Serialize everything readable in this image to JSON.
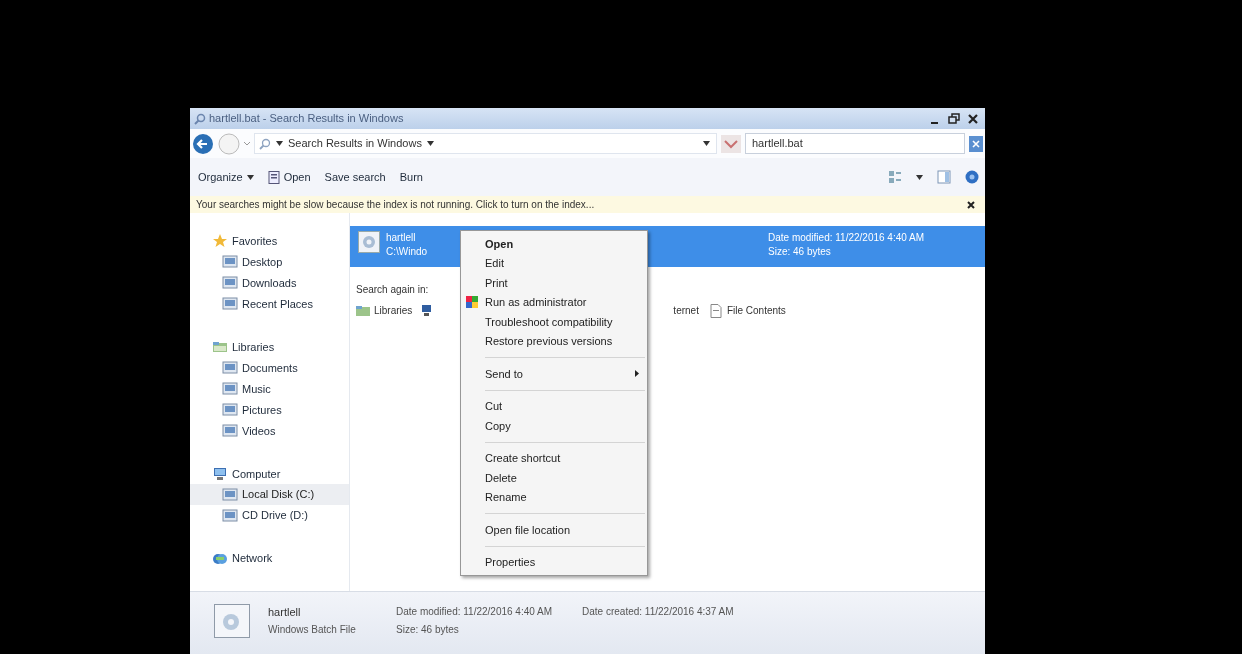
{
  "window": {
    "title": "hartlell.bat - Search Results in Windows"
  },
  "address_bar": {
    "location": "Search Results in Windows",
    "search_value": "hartlell.bat"
  },
  "toolbar": [
    {
      "label": "Organize",
      "dropdown": true,
      "icon": false
    },
    {
      "label": "Open",
      "dropdown": false,
      "icon": true
    },
    {
      "label": "Save search",
      "dropdown": false,
      "icon": false
    },
    {
      "label": "Burn",
      "dropdown": false,
      "icon": false
    }
  ],
  "info_bar": {
    "text": "Your searches might be slow because the index is not running.  Click to turn on the index..."
  },
  "sidebar": [
    {
      "label": "Favorites",
      "children": [
        {
          "label": "Desktop",
          "selected": false
        },
        {
          "label": "Downloads",
          "selected": false
        },
        {
          "label": "Recent Places",
          "selected": false
        }
      ]
    },
    {
      "label": "Libraries",
      "children": [
        {
          "label": "Documents",
          "selected": false
        },
        {
          "label": "Music",
          "selected": false
        },
        {
          "label": "Pictures",
          "selected": false
        },
        {
          "label": "Videos",
          "selected": false
        }
      ]
    },
    {
      "label": "Computer",
      "children": [
        {
          "label": "Local Disk (C:)",
          "selected": true
        },
        {
          "label": "CD Drive (D:)",
          "selected": false
        }
      ]
    },
    {
      "label": "Network"
    }
  ],
  "results": [
    {
      "name": "hartlell",
      "path": "C:\\Windo",
      "date_modified": "Date modified: 11/22/2016 4:40 AM",
      "size": "Size: 46 bytes",
      "selected": true
    }
  ],
  "search_again": {
    "label": "Search again in:",
    "locations": [
      {
        "kind": "full",
        "label": "Libraries"
      },
      {
        "kind": "icon_only"
      },
      {
        "kind": "text_only",
        "label": "ternet"
      },
      {
        "kind": "full",
        "label": "File Contents"
      }
    ]
  },
  "context_menu": [
    [
      {
        "label": "Open",
        "default": true,
        "shield": false,
        "submenu": false
      },
      {
        "label": "Edit",
        "default": false,
        "shield": false,
        "submenu": false
      },
      {
        "label": "Print",
        "default": false,
        "shield": false,
        "submenu": false
      },
      {
        "label": "Run as administrator",
        "default": false,
        "shield": true,
        "submenu": false
      },
      {
        "label": "Troubleshoot compatibility",
        "default": false,
        "shield": false,
        "submenu": false
      },
      {
        "label": "Restore previous versions",
        "default": false,
        "shield": false,
        "submenu": false
      }
    ],
    [
      {
        "label": "Send to",
        "default": false,
        "shield": false,
        "submenu": true
      }
    ],
    [
      {
        "label": "Cut",
        "default": false,
        "shield": false,
        "submenu": false
      },
      {
        "label": "Copy",
        "default": false,
        "shield": false,
        "submenu": false
      }
    ],
    [
      {
        "label": "Create shortcut",
        "default": false,
        "shield": false,
        "submenu": false
      },
      {
        "label": "Delete",
        "default": false,
        "shield": false,
        "submenu": false
      },
      {
        "label": "Rename",
        "default": false,
        "shield": false,
        "submenu": false
      }
    ],
    [
      {
        "label": "Open file location",
        "default": false,
        "shield": false,
        "submenu": false
      }
    ],
    [
      {
        "label": "Properties",
        "default": false,
        "shield": false,
        "submenu": false
      }
    ]
  ],
  "details_pane": {
    "name": "hartlell",
    "type": "Windows Batch File",
    "fields": [
      {
        "label": "Date modified:",
        "value": "11/22/2016 4:40 AM"
      },
      {
        "label": "Size:",
        "value": "46 bytes"
      },
      {
        "label": "Date created:",
        "value": "11/22/2016 4:37 AM"
      }
    ]
  }
}
